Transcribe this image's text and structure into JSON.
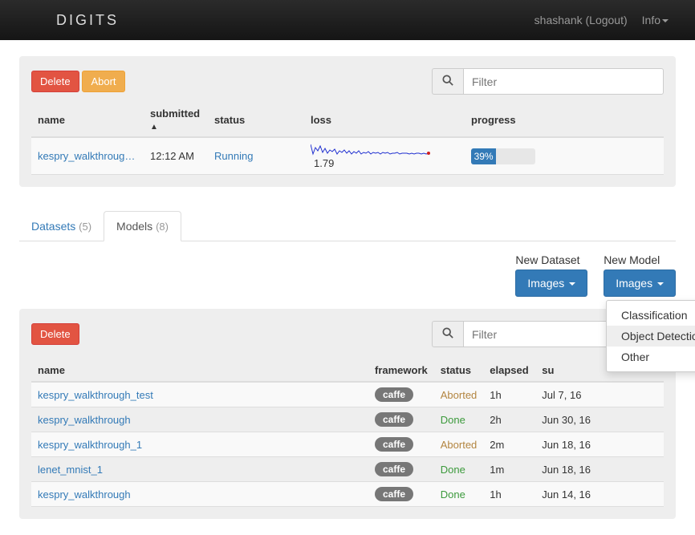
{
  "navbar": {
    "brand": "DIGITS",
    "user": "shashank (Logout)",
    "info": "Info"
  },
  "running_jobs": {
    "delete_label": "Delete",
    "abort_label": "Abort",
    "filter_placeholder": "Filter",
    "columns": {
      "name": "name",
      "submitted": "submitted",
      "status": "status",
      "loss": "loss",
      "progress": "progress"
    },
    "row": {
      "name": "kespry_walkthroug…",
      "submitted": "12:12 AM",
      "status": "Running",
      "loss_value": "1.79",
      "progress_label": "39%",
      "progress_pct": 39
    }
  },
  "tabs": {
    "datasets_label": "Datasets",
    "datasets_count": "(5)",
    "models_label": "Models",
    "models_count": "(8)"
  },
  "actions": {
    "new_dataset_label": "New Dataset",
    "new_model_label": "New Model",
    "images_label": "Images",
    "dropdown": {
      "classification": "Classification",
      "object_detection": "Object Detection",
      "other": "Other"
    }
  },
  "models_panel": {
    "delete_label": "Delete",
    "filter_placeholder": "Filter",
    "columns": {
      "name": "name",
      "framework": "framework",
      "status": "status",
      "elapsed": "elapsed",
      "submitted": "su"
    },
    "rows": [
      {
        "name": "kespry_walkthrough_test",
        "framework": "caffe",
        "status": "Aborted",
        "status_class": "aborted",
        "elapsed": "1h",
        "submitted": "Jul 7, 16"
      },
      {
        "name": "kespry_walkthrough",
        "framework": "caffe",
        "status": "Done",
        "status_class": "done",
        "elapsed": "2h",
        "submitted": "Jun 30, 16"
      },
      {
        "name": "kespry_walkthrough_1",
        "framework": "caffe",
        "status": "Aborted",
        "status_class": "aborted",
        "elapsed": "2m",
        "submitted": "Jun 18, 16"
      },
      {
        "name": "lenet_mnist_1",
        "framework": "caffe",
        "status": "Done",
        "status_class": "done",
        "elapsed": "1m",
        "submitted": "Jun 18, 16"
      },
      {
        "name": "kespry_walkthrough",
        "framework": "caffe",
        "status": "Done",
        "status_class": "done",
        "elapsed": "1h",
        "submitted": "Jun 14, 16"
      }
    ]
  }
}
